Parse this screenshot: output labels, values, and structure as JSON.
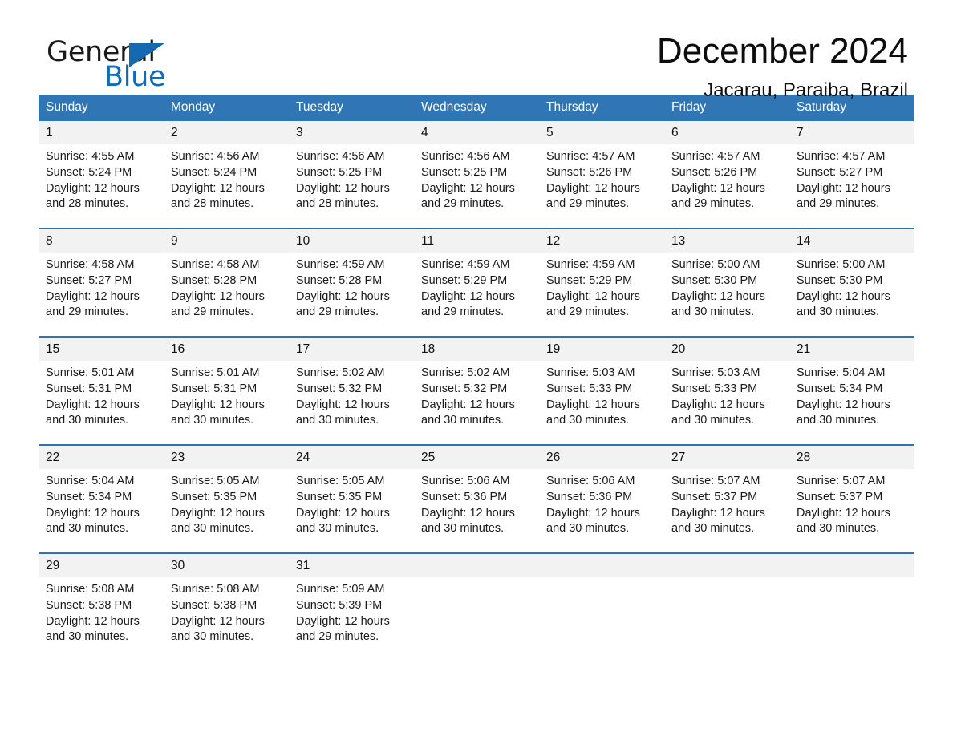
{
  "brand": {
    "word_one": "General",
    "word_two": "Blue",
    "triangle_icon": "brand-triangle-icon",
    "accent_color": "#0f6cb5"
  },
  "header": {
    "title": "December 2024",
    "location": "Jacarau, Paraiba, Brazil"
  },
  "theme": {
    "header_blue": "#3075b4",
    "separator_blue": "#2e74b5",
    "daynum_band": "#f2f2f2",
    "page_background": "#ffffff"
  },
  "calendar": {
    "weekday_headers": [
      "Sunday",
      "Monday",
      "Tuesday",
      "Wednesday",
      "Thursday",
      "Friday",
      "Saturday"
    ],
    "labels": {
      "sunrise": "Sunrise:",
      "sunset": "Sunset:",
      "daylight": "Daylight:"
    },
    "weeks": [
      [
        {
          "day": "1",
          "sunrise": "Sunrise: 4:55 AM",
          "sunset": "Sunset: 5:24 PM",
          "daylight_line1": "Daylight: 12 hours",
          "daylight_line2": "and 28 minutes."
        },
        {
          "day": "2",
          "sunrise": "Sunrise: 4:56 AM",
          "sunset": "Sunset: 5:24 PM",
          "daylight_line1": "Daylight: 12 hours",
          "daylight_line2": "and 28 minutes."
        },
        {
          "day": "3",
          "sunrise": "Sunrise: 4:56 AM",
          "sunset": "Sunset: 5:25 PM",
          "daylight_line1": "Daylight: 12 hours",
          "daylight_line2": "and 28 minutes."
        },
        {
          "day": "4",
          "sunrise": "Sunrise: 4:56 AM",
          "sunset": "Sunset: 5:25 PM",
          "daylight_line1": "Daylight: 12 hours",
          "daylight_line2": "and 29 minutes."
        },
        {
          "day": "5",
          "sunrise": "Sunrise: 4:57 AM",
          "sunset": "Sunset: 5:26 PM",
          "daylight_line1": "Daylight: 12 hours",
          "daylight_line2": "and 29 minutes."
        },
        {
          "day": "6",
          "sunrise": "Sunrise: 4:57 AM",
          "sunset": "Sunset: 5:26 PM",
          "daylight_line1": "Daylight: 12 hours",
          "daylight_line2": "and 29 minutes."
        },
        {
          "day": "7",
          "sunrise": "Sunrise: 4:57 AM",
          "sunset": "Sunset: 5:27 PM",
          "daylight_line1": "Daylight: 12 hours",
          "daylight_line2": "and 29 minutes."
        }
      ],
      [
        {
          "day": "8",
          "sunrise": "Sunrise: 4:58 AM",
          "sunset": "Sunset: 5:27 PM",
          "daylight_line1": "Daylight: 12 hours",
          "daylight_line2": "and 29 minutes."
        },
        {
          "day": "9",
          "sunrise": "Sunrise: 4:58 AM",
          "sunset": "Sunset: 5:28 PM",
          "daylight_line1": "Daylight: 12 hours",
          "daylight_line2": "and 29 minutes."
        },
        {
          "day": "10",
          "sunrise": "Sunrise: 4:59 AM",
          "sunset": "Sunset: 5:28 PM",
          "daylight_line1": "Daylight: 12 hours",
          "daylight_line2": "and 29 minutes."
        },
        {
          "day": "11",
          "sunrise": "Sunrise: 4:59 AM",
          "sunset": "Sunset: 5:29 PM",
          "daylight_line1": "Daylight: 12 hours",
          "daylight_line2": "and 29 minutes."
        },
        {
          "day": "12",
          "sunrise": "Sunrise: 4:59 AM",
          "sunset": "Sunset: 5:29 PM",
          "daylight_line1": "Daylight: 12 hours",
          "daylight_line2": "and 29 minutes."
        },
        {
          "day": "13",
          "sunrise": "Sunrise: 5:00 AM",
          "sunset": "Sunset: 5:30 PM",
          "daylight_line1": "Daylight: 12 hours",
          "daylight_line2": "and 30 minutes."
        },
        {
          "day": "14",
          "sunrise": "Sunrise: 5:00 AM",
          "sunset": "Sunset: 5:30 PM",
          "daylight_line1": "Daylight: 12 hours",
          "daylight_line2": "and 30 minutes."
        }
      ],
      [
        {
          "day": "15",
          "sunrise": "Sunrise: 5:01 AM",
          "sunset": "Sunset: 5:31 PM",
          "daylight_line1": "Daylight: 12 hours",
          "daylight_line2": "and 30 minutes."
        },
        {
          "day": "16",
          "sunrise": "Sunrise: 5:01 AM",
          "sunset": "Sunset: 5:31 PM",
          "daylight_line1": "Daylight: 12 hours",
          "daylight_line2": "and 30 minutes."
        },
        {
          "day": "17",
          "sunrise": "Sunrise: 5:02 AM",
          "sunset": "Sunset: 5:32 PM",
          "daylight_line1": "Daylight: 12 hours",
          "daylight_line2": "and 30 minutes."
        },
        {
          "day": "18",
          "sunrise": "Sunrise: 5:02 AM",
          "sunset": "Sunset: 5:32 PM",
          "daylight_line1": "Daylight: 12 hours",
          "daylight_line2": "and 30 minutes."
        },
        {
          "day": "19",
          "sunrise": "Sunrise: 5:03 AM",
          "sunset": "Sunset: 5:33 PM",
          "daylight_line1": "Daylight: 12 hours",
          "daylight_line2": "and 30 minutes."
        },
        {
          "day": "20",
          "sunrise": "Sunrise: 5:03 AM",
          "sunset": "Sunset: 5:33 PM",
          "daylight_line1": "Daylight: 12 hours",
          "daylight_line2": "and 30 minutes."
        },
        {
          "day": "21",
          "sunrise": "Sunrise: 5:04 AM",
          "sunset": "Sunset: 5:34 PM",
          "daylight_line1": "Daylight: 12 hours",
          "daylight_line2": "and 30 minutes."
        }
      ],
      [
        {
          "day": "22",
          "sunrise": "Sunrise: 5:04 AM",
          "sunset": "Sunset: 5:34 PM",
          "daylight_line1": "Daylight: 12 hours",
          "daylight_line2": "and 30 minutes."
        },
        {
          "day": "23",
          "sunrise": "Sunrise: 5:05 AM",
          "sunset": "Sunset: 5:35 PM",
          "daylight_line1": "Daylight: 12 hours",
          "daylight_line2": "and 30 minutes."
        },
        {
          "day": "24",
          "sunrise": "Sunrise: 5:05 AM",
          "sunset": "Sunset: 5:35 PM",
          "daylight_line1": "Daylight: 12 hours",
          "daylight_line2": "and 30 minutes."
        },
        {
          "day": "25",
          "sunrise": "Sunrise: 5:06 AM",
          "sunset": "Sunset: 5:36 PM",
          "daylight_line1": "Daylight: 12 hours",
          "daylight_line2": "and 30 minutes."
        },
        {
          "day": "26",
          "sunrise": "Sunrise: 5:06 AM",
          "sunset": "Sunset: 5:36 PM",
          "daylight_line1": "Daylight: 12 hours",
          "daylight_line2": "and 30 minutes."
        },
        {
          "day": "27",
          "sunrise": "Sunrise: 5:07 AM",
          "sunset": "Sunset: 5:37 PM",
          "daylight_line1": "Daylight: 12 hours",
          "daylight_line2": "and 30 minutes."
        },
        {
          "day": "28",
          "sunrise": "Sunrise: 5:07 AM",
          "sunset": "Sunset: 5:37 PM",
          "daylight_line1": "Daylight: 12 hours",
          "daylight_line2": "and 30 minutes."
        }
      ],
      [
        {
          "day": "29",
          "sunrise": "Sunrise: 5:08 AM",
          "sunset": "Sunset: 5:38 PM",
          "daylight_line1": "Daylight: 12 hours",
          "daylight_line2": "and 30 minutes."
        },
        {
          "day": "30",
          "sunrise": "Sunrise: 5:08 AM",
          "sunset": "Sunset: 5:38 PM",
          "daylight_line1": "Daylight: 12 hours",
          "daylight_line2": "and 30 minutes."
        },
        {
          "day": "31",
          "sunrise": "Sunrise: 5:09 AM",
          "sunset": "Sunset: 5:39 PM",
          "daylight_line1": "Daylight: 12 hours",
          "daylight_line2": "and 29 minutes."
        },
        {
          "day": "",
          "sunrise": "",
          "sunset": "",
          "daylight_line1": "",
          "daylight_line2": ""
        },
        {
          "day": "",
          "sunrise": "",
          "sunset": "",
          "daylight_line1": "",
          "daylight_line2": ""
        },
        {
          "day": "",
          "sunrise": "",
          "sunset": "",
          "daylight_line1": "",
          "daylight_line2": ""
        },
        {
          "day": "",
          "sunrise": "",
          "sunset": "",
          "daylight_line1": "",
          "daylight_line2": ""
        }
      ]
    ]
  }
}
